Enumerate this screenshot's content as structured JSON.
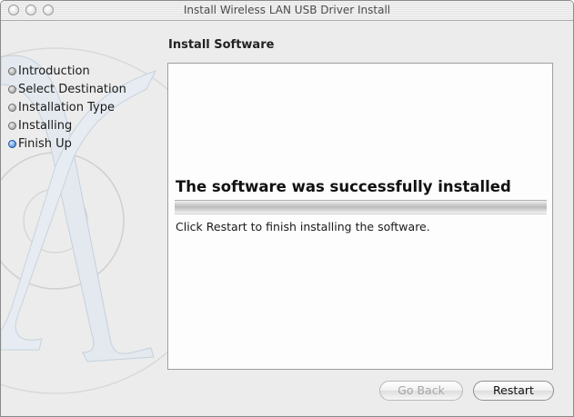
{
  "window": {
    "title": "Install Wireless LAN USB Driver Install"
  },
  "section_title": "Install Software",
  "steps": [
    {
      "label": "Introduction",
      "active": false
    },
    {
      "label": "Select Destination",
      "active": false
    },
    {
      "label": "Installation Type",
      "active": false
    },
    {
      "label": "Installing",
      "active": false
    },
    {
      "label": "Finish Up",
      "active": true
    }
  ],
  "panel": {
    "headline": "The software was successfully installed",
    "message": "Click Restart to finish installing the software.",
    "progress_fraction": 1.0
  },
  "buttons": {
    "go_back": "Go Back",
    "restart": "Restart"
  },
  "colors": {
    "active_step_bullet": "#2a71c9",
    "window_bg": "#ececec",
    "panel_bg": "#fdfdfd"
  }
}
